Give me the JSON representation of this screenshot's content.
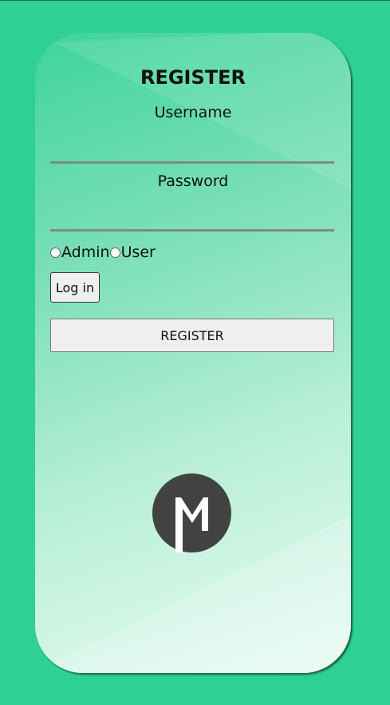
{
  "form": {
    "title": "REGISTER",
    "username_label": "Username",
    "username_value": "",
    "password_label": "Password",
    "password_value": "",
    "roles": [
      {
        "label": "Admin",
        "selected": false
      },
      {
        "label": "User",
        "selected": false
      }
    ],
    "login_label": "Log in",
    "register_label": "REGISTER"
  },
  "logo": {
    "icon": "m-logo-icon",
    "color": "#424242"
  },
  "colors": {
    "background": "#2ed093",
    "card_top": "#3fd49b",
    "card_bottom": "#eafcf4",
    "button": "#efefef"
  }
}
